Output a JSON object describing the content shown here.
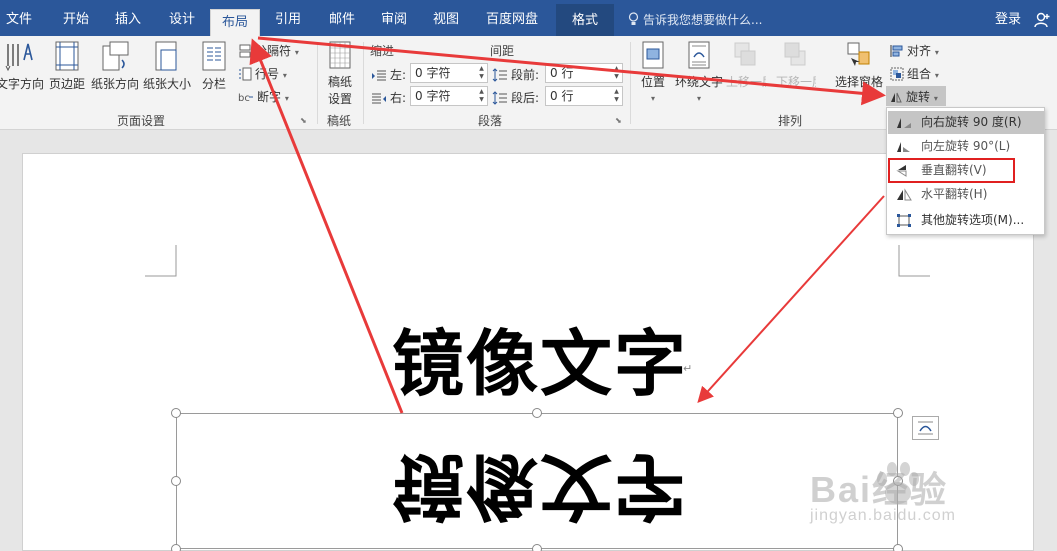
{
  "tabs": {
    "file": "文件",
    "home": "开始",
    "insert": "插入",
    "design": "设计",
    "layout": "布局",
    "references": "引用",
    "mailings": "邮件",
    "review": "审阅",
    "view": "视图",
    "baidu": "百度网盘",
    "format": "格式"
  },
  "tell_me": "告诉我您想要做什么...",
  "login": "登录",
  "page_setup": {
    "text_direction": "文字方向",
    "margins": "页边距",
    "orientation": "纸张方向",
    "size": "纸张大小",
    "columns": "分栏",
    "breaks": "分隔符",
    "line_numbers": "行号",
    "hyphenation": "断字",
    "group_label": "页面设置"
  },
  "manuscript": {
    "button_line1": "稿纸",
    "button_line2": "设置",
    "group_label": "稿纸"
  },
  "paragraph": {
    "indent_header": "缩进",
    "spacing_header": "间距",
    "left_label": "左:",
    "left_value": "0 字符",
    "right_label": "右:",
    "right_value": "0 字符",
    "before_label": "段前:",
    "before_value": "0 行",
    "after_label": "段后:",
    "after_value": "0 行",
    "group_label": "段落"
  },
  "arrange": {
    "position": "位置",
    "wrap_text": "环绕文字",
    "bring_forward": "上移一层",
    "send_backward": "下移一层",
    "selection_pane": "选择窗格",
    "align": "对齐",
    "group": "组合",
    "rotate": "旋转",
    "group_label": "排列"
  },
  "rotate_menu": {
    "right90": "向右旋转 90 度(R)",
    "left90": "向左旋转 90°(L)",
    "flip_vertical": "垂直翻转(V)",
    "flip_horizontal": "水平翻转(H)",
    "more": "其他旋转选项(M)..."
  },
  "document": {
    "title_text": "镜像文字",
    "flipped_text": "镜像文字",
    "paragraph_mark": "↵"
  },
  "watermark": {
    "brand": "Bai经验",
    "url": "jingyan.baidu.com"
  },
  "colors": {
    "tab_bar": "#2b579a",
    "annotation_red": "#e83a3a"
  }
}
